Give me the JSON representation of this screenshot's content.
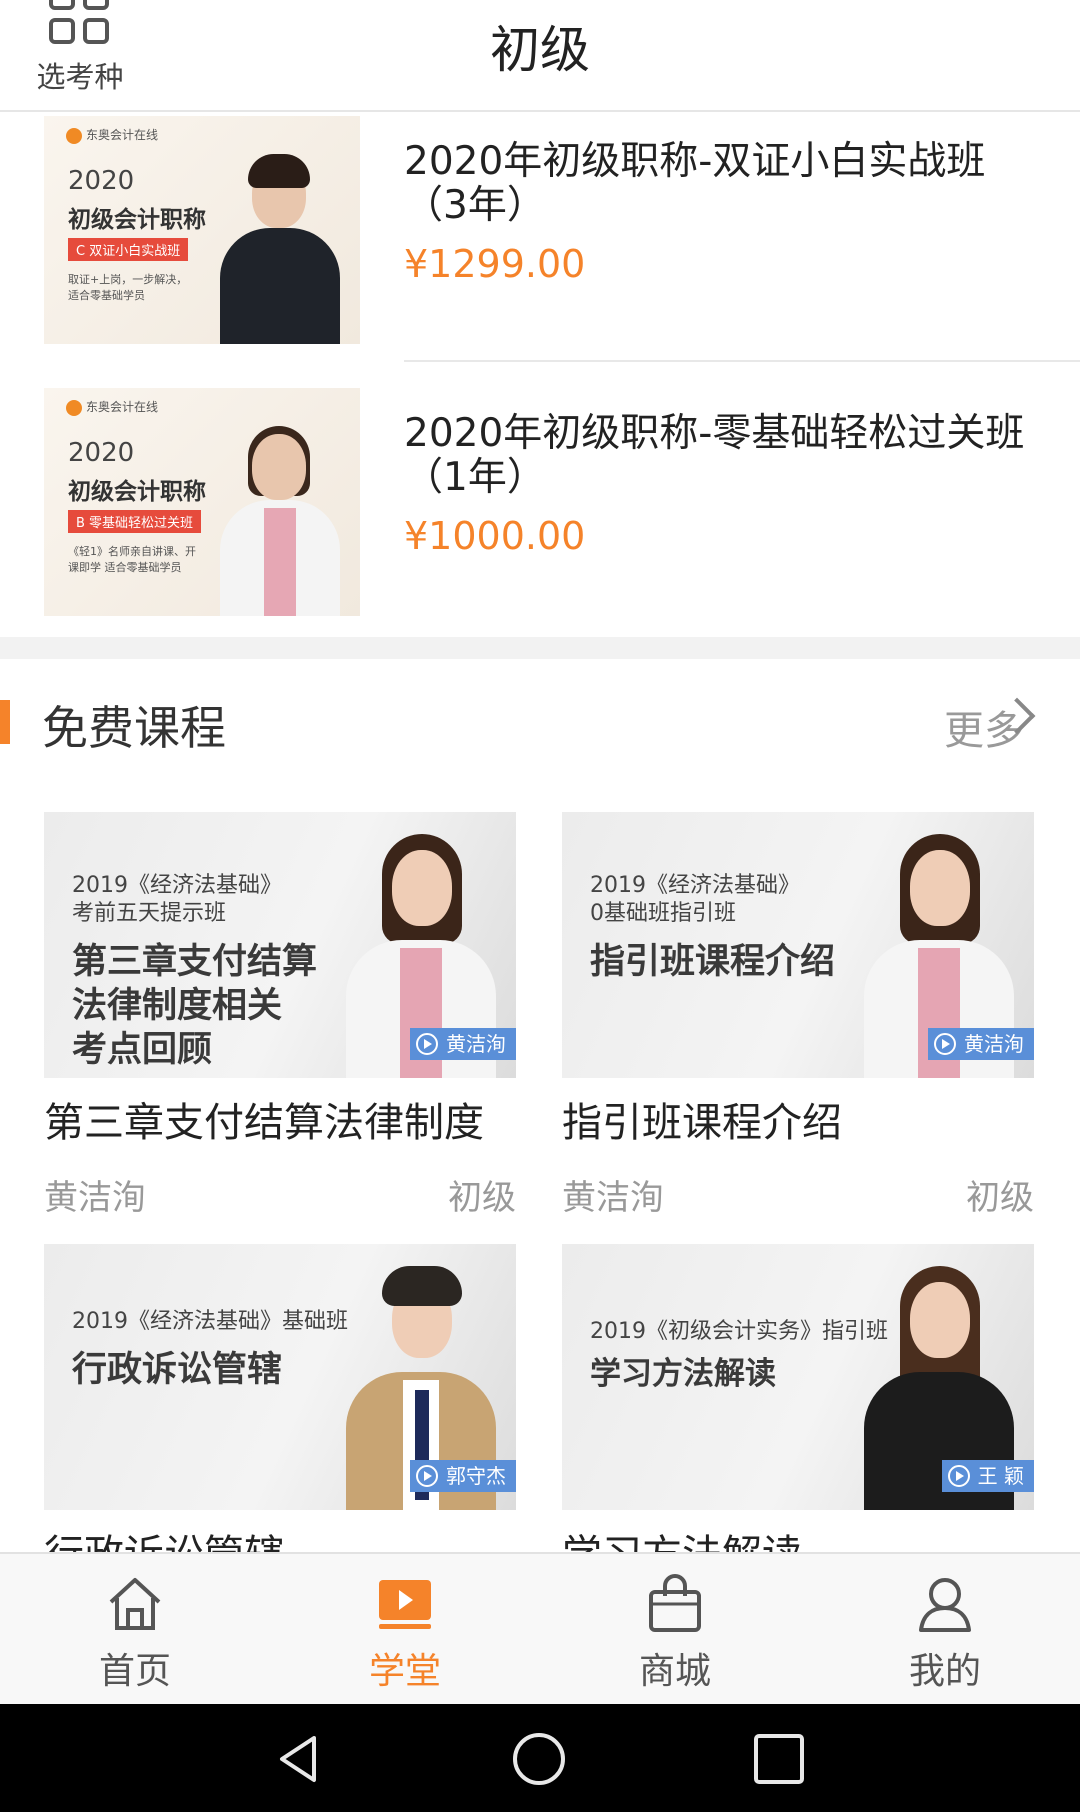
{
  "header": {
    "exam_switch_label": "选考种",
    "title": "初级"
  },
  "paid_courses": [
    {
      "name": "2020年初级职称-双证小白实战班（3年）",
      "price": "¥1299.00",
      "thumb": {
        "brand": "东奥会计在线",
        "year": "2020",
        "title": "初级会计职称",
        "tag": "C 双证小白实战班",
        "desc": "取证+上岗，一步解决，适合零基础学员"
      }
    },
    {
      "name": "2020年初级职称-零基础轻松过关班（1年）",
      "price": "¥1000.00",
      "thumb": {
        "brand": "东奥会计在线",
        "year": "2020",
        "title": "初级会计职称",
        "tag": "B 零基础轻松过关班",
        "desc": "《轻1》名师亲自讲课、开课即学 适合零基础学员"
      }
    }
  ],
  "free_section": {
    "title": "免费课程",
    "more_label": "更多"
  },
  "free_courses": [
    {
      "thumb_sub": "2019《经济法基础》\n考前五天提示班",
      "thumb_big": "第三章支付结算\n法律制度相关\n考点回顾",
      "badge": "黄洁洵",
      "title": "第三章支付结算法律制度",
      "teacher": "黄洁洵",
      "level": "初级"
    },
    {
      "thumb_sub": "2019《经济法基础》\n0基础班指引班",
      "thumb_big": "指引班课程介绍",
      "badge": "黄洁洵",
      "title": "指引班课程介绍",
      "teacher": "黄洁洵",
      "level": "初级"
    },
    {
      "thumb_sub": "2019《经济法基础》基础班",
      "thumb_big": "行政诉讼管辖",
      "badge": "郭守杰",
      "title": "行政诉讼管辖"
    },
    {
      "thumb_sub": "2019《初级会计实务》指引班",
      "thumb_big": "学习方法解读",
      "badge": "王 颖",
      "title": "学习方法解读"
    }
  ],
  "tabbar": {
    "items": [
      {
        "label": "首页",
        "icon": "home-icon"
      },
      {
        "label": "学堂",
        "icon": "classroom-icon"
      },
      {
        "label": "商城",
        "icon": "shop-bag-icon"
      },
      {
        "label": "我的",
        "icon": "profile-icon"
      }
    ],
    "active_color": "#f5832a"
  },
  "colors": {
    "accent": "#f5832a",
    "badge": "#5a8fd8"
  }
}
